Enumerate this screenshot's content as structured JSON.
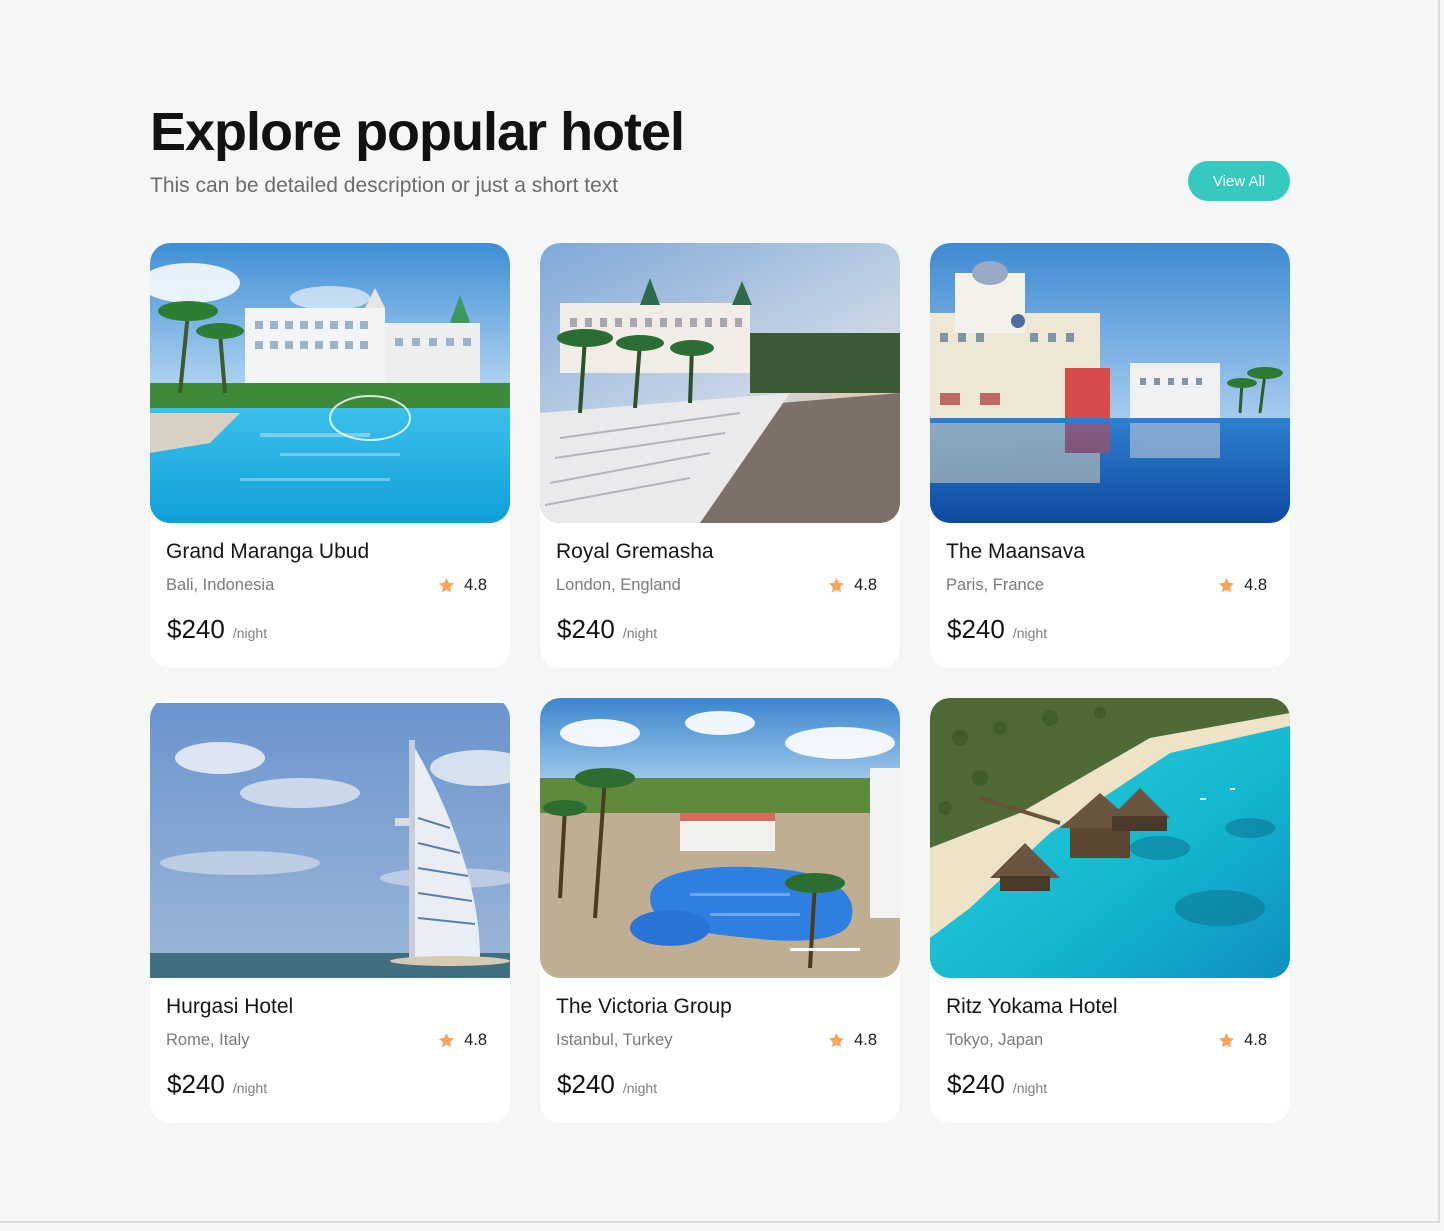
{
  "section": {
    "title": "Explore popular hotel",
    "subtitle": "This can be detailed description or just a short text",
    "view_all_label": "View All"
  },
  "colors": {
    "accent": "#35c9c0",
    "star": "#f6a55a",
    "background": "#f4f7f5"
  },
  "icons": {
    "rating": "star-icon"
  },
  "hotels": [
    {
      "name": "Grand Maranga Ubud",
      "location": "Bali, Indonesia",
      "rating": "4.8",
      "price": "$240",
      "unit": "/night"
    },
    {
      "name": "Royal Gremasha",
      "location": "London, England",
      "rating": "4.8",
      "price": "$240",
      "unit": "/night"
    },
    {
      "name": "The Maansava",
      "location": "Paris, France",
      "rating": "4.8",
      "price": "$240",
      "unit": "/night"
    },
    {
      "name": "Hurgasi Hotel",
      "location": "Rome, Italy",
      "rating": "4.8",
      "price": "$240",
      "unit": "/night"
    },
    {
      "name": "The Victoria Group",
      "location": "Istanbul, Turkey",
      "rating": "4.8",
      "price": "$240",
      "unit": "/night"
    },
    {
      "name": "Ritz Yokama Hotel",
      "location": "Tokyo, Japan",
      "rating": "4.8",
      "price": "$240",
      "unit": "/night"
    }
  ]
}
